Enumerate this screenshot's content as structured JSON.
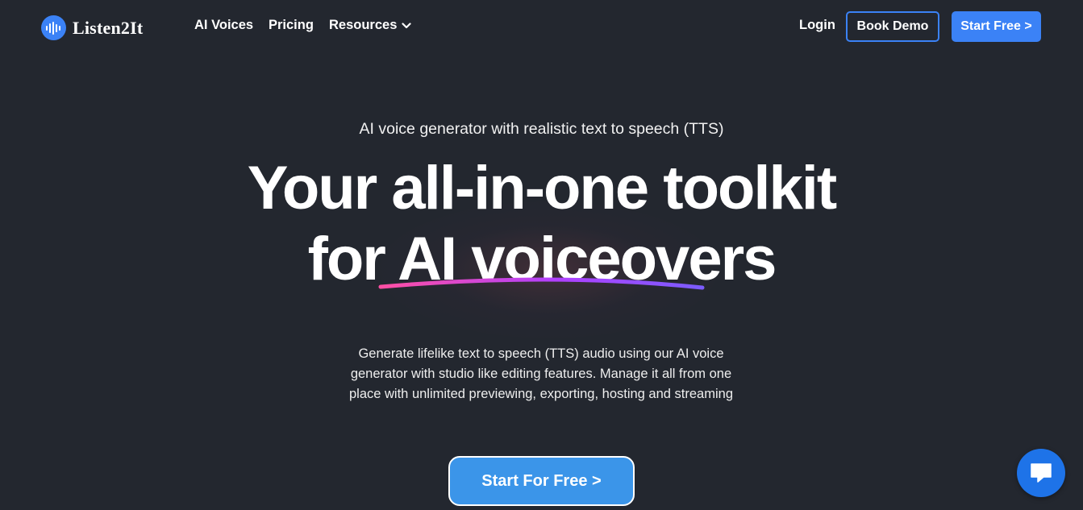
{
  "nav": {
    "brand": "Listen2It",
    "links": [
      {
        "label": "AI Voices"
      },
      {
        "label": "Pricing"
      },
      {
        "label": "Resources"
      }
    ],
    "login_label": "Login",
    "demo_label": "Book Demo",
    "start_label": "Start Free >"
  },
  "hero": {
    "eyebrow": "AI voice generator with realistic text to speech (TTS)",
    "headline_line1": "Your all-in-one toolkit",
    "headline_line2_prefix": "for ",
    "headline_line2_highlight": "AI voiceovers",
    "description": "Generate lifelike text to speech (TTS) audio using our AI voice generator with studio like editing features.  Manage it all from one place with unlimited previewing, exporting, hosting and streaming",
    "cta_label": "Start For Free >"
  },
  "icons": {
    "logo": "sound-wave-icon",
    "resources_caret": "chevron-down-icon",
    "chat": "chat-bubble-icon"
  },
  "colors": {
    "background": "#23272f",
    "accent": "#3b82f6",
    "cta": "#3b95e9",
    "chat": "#1e73e8",
    "underline_start": "#ff4fa3",
    "underline_end": "#7b5cff"
  }
}
